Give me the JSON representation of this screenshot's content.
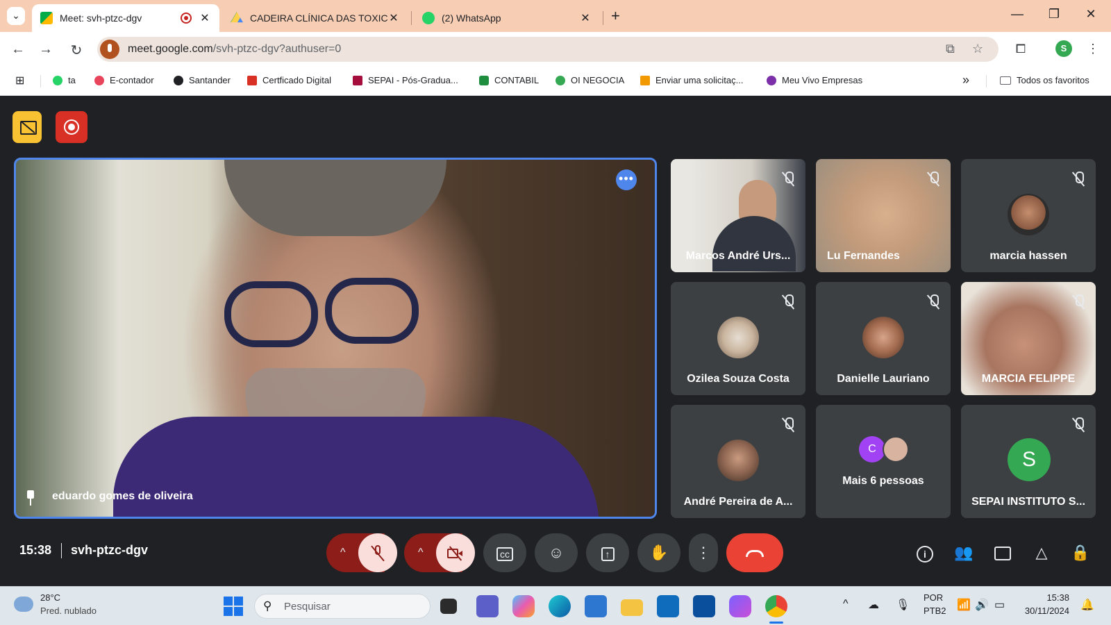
{
  "browser": {
    "tabs": [
      {
        "title": "Meet: svh-ptzc-dgv",
        "active": true,
        "recording": true
      },
      {
        "title": "CADEIRA CLÍNICA DAS TOXICO",
        "active": false
      },
      {
        "title": "(2) WhatsApp",
        "active": false
      }
    ],
    "new_tab": "+",
    "url_host": "meet.google.com",
    "url_path": "/svh-ptzc-dgv?authuser=0",
    "profile_initial": "S",
    "bookmarks": [
      {
        "label": "ta",
        "color": "#25d366"
      },
      {
        "label": "E-contador",
        "color": "#e8455d"
      },
      {
        "label": "Santander",
        "color": "#202124"
      },
      {
        "label": "Certficado Digital",
        "color": "#d93025"
      },
      {
        "label": "SEPAI - Pós-Gradua...",
        "color": "#a50e3c"
      },
      {
        "label": "CONTABIL",
        "color": "#1e8e3e"
      },
      {
        "label": "OI NEGOCIA",
        "color": "#34a853"
      },
      {
        "label": "Enviar uma solicitaç...",
        "color": "#f29900"
      },
      {
        "label": "Meu Vivo Empresas",
        "color": "#7b2fa8"
      }
    ],
    "bookmarks_overflow": "»",
    "all_bookmarks": "Todos os favoritos"
  },
  "meet": {
    "main_speaker": {
      "name": "eduardo gomes de oliveira"
    },
    "participants": [
      {
        "name": "Marcos André Urs..."
      },
      {
        "name": "Lu Fernandes"
      },
      {
        "name": "marcia hassen"
      },
      {
        "name": "Ozilea Souza Costa"
      },
      {
        "name": "Danielle Lauriano"
      },
      {
        "name": "MARCIA FELIPPE"
      },
      {
        "name": "André Pereira de A..."
      },
      {
        "name": "Mais 6 pessoas",
        "avatar_letter": "C"
      },
      {
        "name": "SEPAI INSTITUTO S...",
        "avatar_letter": "S"
      }
    ],
    "time": "15:38",
    "meeting_code": "svh-ptzc-dgv"
  },
  "taskbar": {
    "temperature": "28°C",
    "weather": "Pred. nublado",
    "search_placeholder": "Pesquisar",
    "lang1": "POR",
    "lang2": "PTB2",
    "time": "15:38",
    "date": "30/11/2024"
  },
  "colors": {
    "accent_blue": "#4f86ec",
    "end_call_red": "#ea4335",
    "meet_background": "#202124",
    "tile_background": "#3c4043"
  }
}
